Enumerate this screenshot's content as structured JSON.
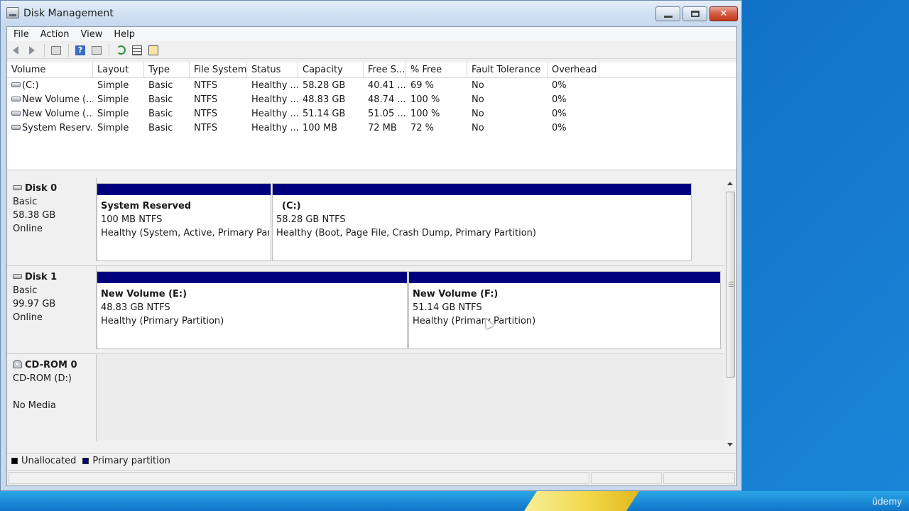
{
  "window": {
    "title": "Disk Management"
  },
  "menu": {
    "items": [
      "File",
      "Action",
      "View",
      "Help"
    ]
  },
  "toolbar": {
    "buttons": [
      "back-arrow-icon",
      "forward-arrow-icon",
      "console-tree-icon",
      "help-icon",
      "show-pane-icon",
      "refresh-icon",
      "properties-icon",
      "rescan-icon"
    ]
  },
  "volume_list": {
    "columns": [
      "Volume",
      "Layout",
      "Type",
      "File System",
      "Status",
      "Capacity",
      "Free S...",
      "% Free",
      "Fault Tolerance",
      "Overhead"
    ],
    "rows": [
      [
        "(C:)",
        "Simple",
        "Basic",
        "NTFS",
        "Healthy ...",
        "58.28 GB",
        "40.41 ...",
        "69 %",
        "No",
        "0%"
      ],
      [
        "New Volume (...",
        "Simple",
        "Basic",
        "NTFS",
        "Healthy ...",
        "48.83 GB",
        "48.74 ...",
        "100 %",
        "No",
        "0%"
      ],
      [
        "New Volume (...",
        "Simple",
        "Basic",
        "NTFS",
        "Healthy ...",
        "51.14 GB",
        "51.05 ...",
        "100 %",
        "No",
        "0%"
      ],
      [
        "System Reserv...",
        "Simple",
        "Basic",
        "NTFS",
        "Healthy ...",
        "100 MB",
        "72 MB",
        "72 %",
        "No",
        "0%"
      ]
    ]
  },
  "disks": {
    "disk0": {
      "name": "Disk 0",
      "type": "Basic",
      "size": "58.38 GB",
      "state": "Online",
      "partitions": [
        {
          "title": "System Reserved",
          "size": "100 MB NTFS",
          "status": "Healthy (System, Active, Primary Parti"
        },
        {
          "title": "(C:)",
          "size": "58.28 GB NTFS",
          "status": "Healthy (Boot, Page File, Crash Dump, Primary Partition)"
        }
      ]
    },
    "disk1": {
      "name": "Disk 1",
      "type": "Basic",
      "size": "99.97 GB",
      "state": "Online",
      "partitions": [
        {
          "title": "New Volume  (E:)",
          "size": "48.83 GB NTFS",
          "status": "Healthy (Primary Partition)"
        },
        {
          "title": "New Volume  (F:)",
          "size": "51.14 GB NTFS",
          "status": "Healthy (Primary Partition)"
        }
      ]
    },
    "cdrom0": {
      "name": "CD-ROM 0",
      "drive": "CD-ROM (D:)",
      "media": "No Media"
    }
  },
  "legend": {
    "unallocated": {
      "label": "Unallocated",
      "color": "#000000"
    },
    "primary": {
      "label": "Primary partition",
      "color": "#00007f"
    }
  },
  "watermark": "ûdemy"
}
